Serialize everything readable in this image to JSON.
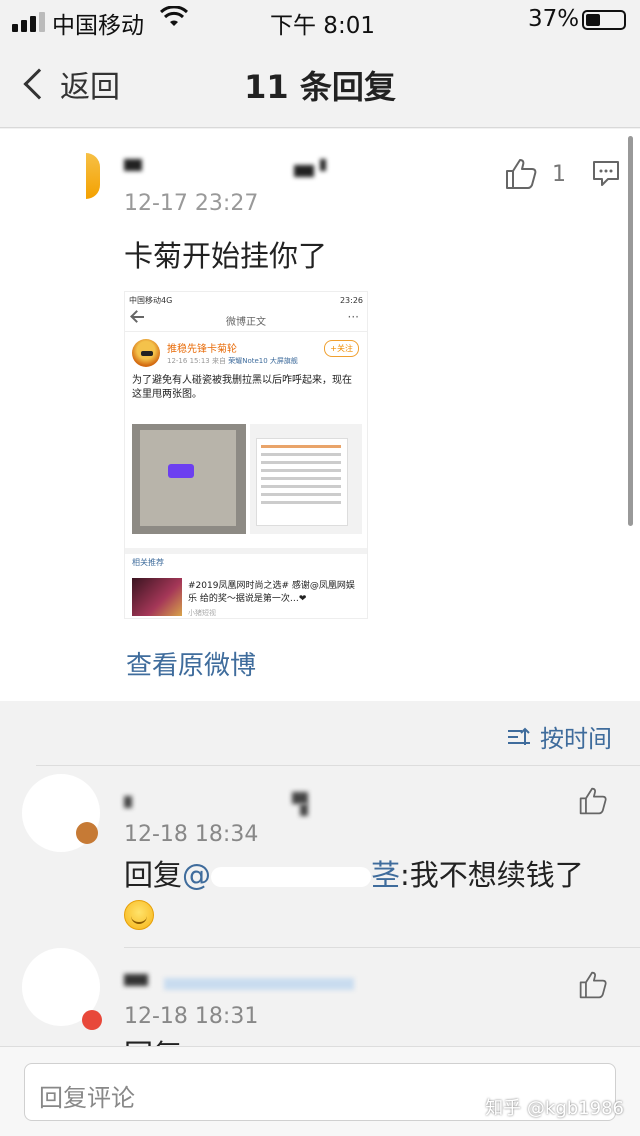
{
  "status_bar": {
    "carrier": "中国移动",
    "time": "下午 8:01",
    "battery_percent": "37%",
    "battery_level": 0.37
  },
  "nav": {
    "back_label": "返回",
    "title": "11 条回复"
  },
  "post": {
    "time": "12-17 23:27",
    "like_count": "1",
    "text": "卡菊开始挂你了",
    "view_original": "查看原微博",
    "embedded": {
      "status_left": "中国移动4G",
      "status_right": "23:26",
      "nav_title": "微博正文",
      "user_name": "推稳先锋卡菊轮",
      "meta_time": "12-16 15:13",
      "meta_from": "来自",
      "meta_source": "荣耀Note10 大屏旗舰",
      "follow_label": "+关注",
      "body": "为了避免有人碰瓷被我删拉黑以后咋呼起来，现在这里甩两张图。",
      "related_label": "相关推荐",
      "related_text": "#2019凤凰网时尚之选# 感谢@凤凰网娱乐 给的奖～据说是第一次…❤",
      "related_meta": "小猪短视"
    }
  },
  "sort": {
    "label": "按时间"
  },
  "replies": [
    {
      "time": "12-18 18:34",
      "prefix": "回复",
      "mention": "@",
      "mention_tail": "茎",
      "text": ":我不想续钱了"
    },
    {
      "time": "12-18 18:31",
      "prefix": "回复"
    }
  ],
  "input": {
    "placeholder": "回复评论"
  },
  "watermark": "知乎 @kgb1986"
}
